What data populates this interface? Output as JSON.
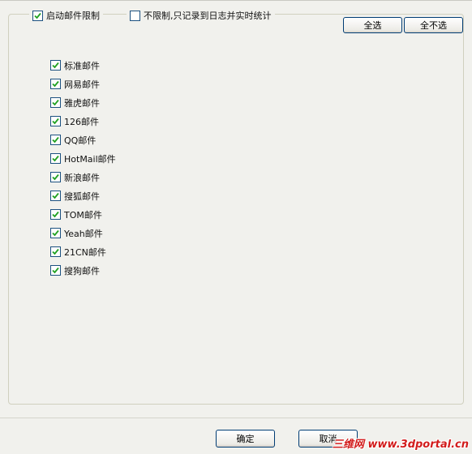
{
  "options": {
    "enable_limit": {
      "label": "启动邮件限制",
      "checked": true
    },
    "no_limit": {
      "label": "不限制,只记录到日志并实时统计",
      "checked": false
    }
  },
  "toolbar": {
    "select_all": "全选",
    "select_none": "全不选"
  },
  "providers": [
    {
      "label": "标准邮件",
      "checked": true
    },
    {
      "label": "网易邮件",
      "checked": true
    },
    {
      "label": "雅虎邮件",
      "checked": true
    },
    {
      "label": "126邮件",
      "checked": true
    },
    {
      "label": "QQ邮件",
      "checked": true
    },
    {
      "label": "HotMail邮件",
      "checked": true
    },
    {
      "label": "新浪邮件",
      "checked": true
    },
    {
      "label": "搜狐邮件",
      "checked": true
    },
    {
      "label": "TOM邮件",
      "checked": true
    },
    {
      "label": "Yeah邮件",
      "checked": true
    },
    {
      "label": "21CN邮件",
      "checked": true
    },
    {
      "label": "搜狗邮件",
      "checked": true
    }
  ],
  "dialog": {
    "ok_label": "确定",
    "cancel_label": "取消"
  },
  "watermark": "三维网 www.3dportal.cn",
  "colors": {
    "background": "#f1f1ed",
    "checkbox_border": "#1c5180",
    "checkmark": "#21a121",
    "button_border": "#003c74",
    "watermark": "#d21c1c"
  }
}
